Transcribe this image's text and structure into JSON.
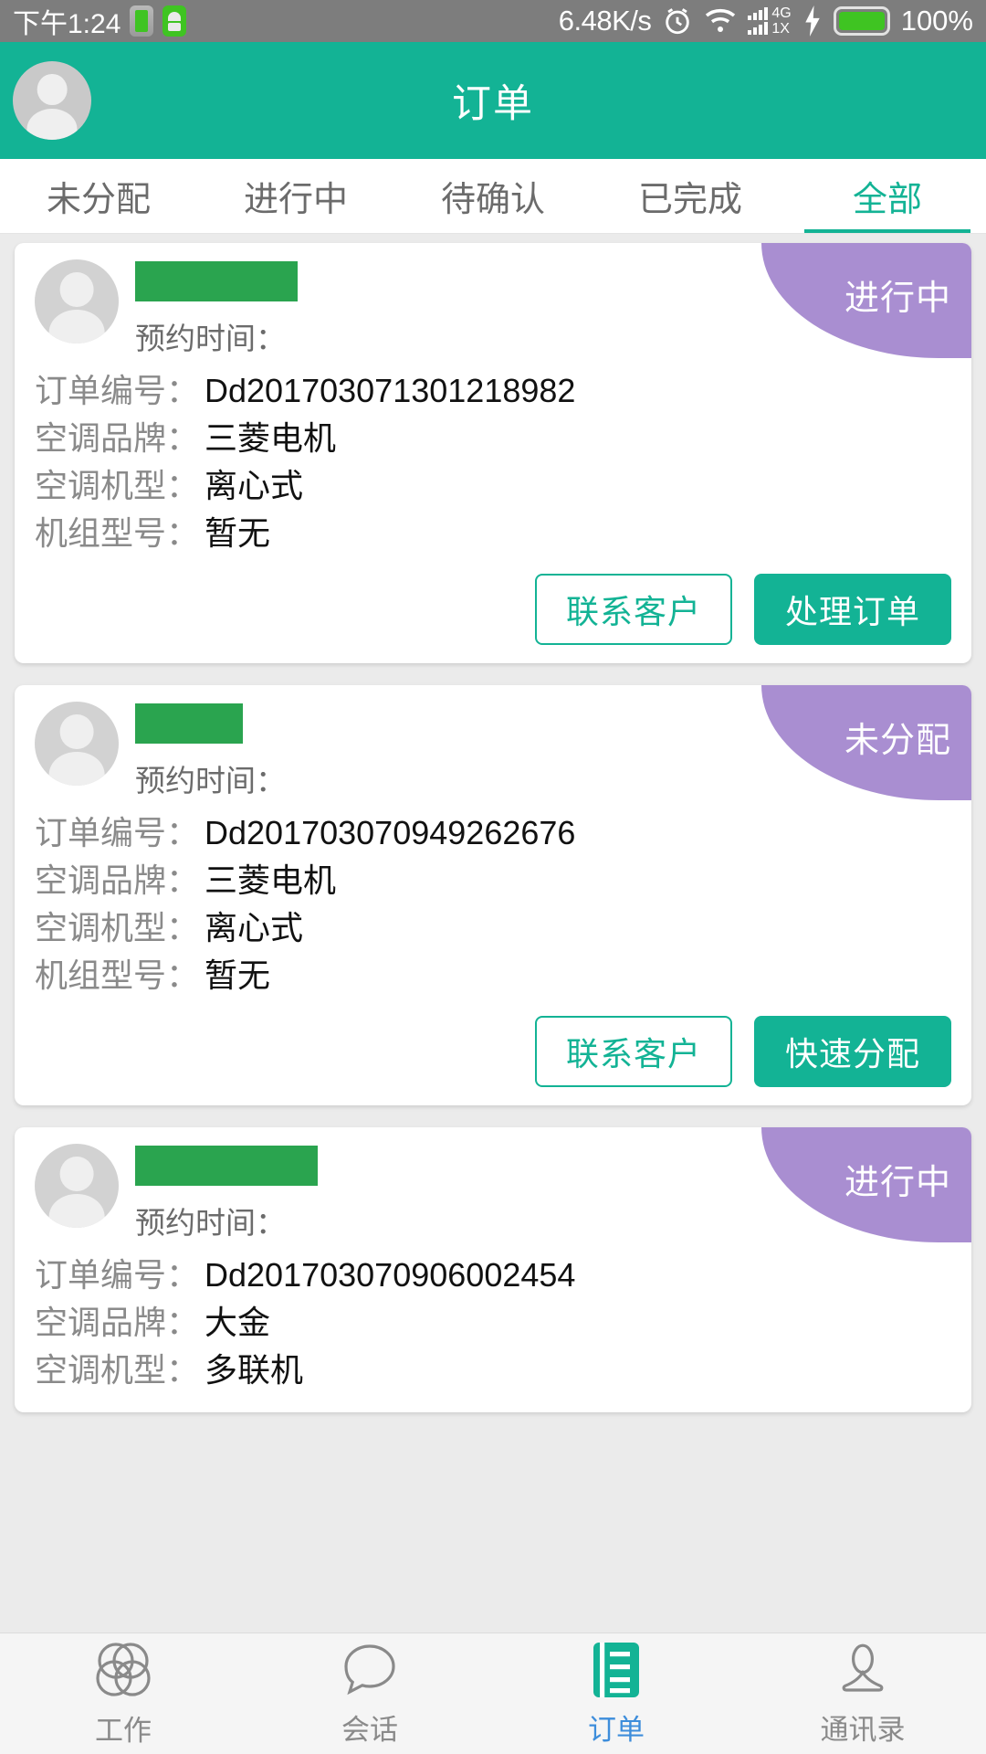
{
  "status_bar": {
    "time": "下午1:24",
    "net_speed": "6.48K/s",
    "network_type": "4G",
    "network_sub": "1X",
    "battery_percent": "100%",
    "icons": [
      "battery-mini-icon",
      "android-robot-icon",
      "alarm-clock-icon",
      "wifi-icon",
      "signal-bars-icon",
      "charging-bolt-icon",
      "battery-icon"
    ],
    "colors": {
      "background": "#7d7d7d",
      "battery_green": "#3fc422"
    }
  },
  "header": {
    "title": "订单",
    "avatar_name": "user-avatar",
    "background": "#13b395"
  },
  "tabs": {
    "active_index": 4,
    "items": [
      {
        "label": "未分配"
      },
      {
        "label": "进行中"
      },
      {
        "label": "待确认"
      },
      {
        "label": "已完成"
      },
      {
        "label": "全部"
      }
    ],
    "active_color": "#13b395",
    "inactive_color": "#6b6b6b"
  },
  "field_labels": {
    "appointment": "预约时间：",
    "order_no": "订单编号：",
    "brand": "空调品牌：",
    "model_type": "空调机型：",
    "unit_model": "机组型号："
  },
  "badge_color": "#a98ed1",
  "redaction_color": "#2aa44f",
  "orders": [
    {
      "status_badge": "进行中",
      "customer_redacted_width": 178,
      "appointment_time": "",
      "order_no": "Dd201703071301218982",
      "brand": "三菱电机",
      "model_type": "离心式",
      "unit_model": "暂无",
      "buttons": {
        "secondary": "联系客户",
        "primary": "处理订单"
      }
    },
    {
      "status_badge": "未分配",
      "customer_redacted_width": 118,
      "appointment_time": "",
      "order_no": "Dd201703070949262676",
      "brand": "三菱电机",
      "model_type": "离心式",
      "unit_model": "暂无",
      "buttons": {
        "secondary": "联系客户",
        "primary": "快速分配"
      }
    },
    {
      "status_badge": "进行中",
      "customer_redacted_width": 200,
      "appointment_time": "",
      "order_no": "Dd201703070906002454",
      "brand": "大金",
      "model_type": "多联机",
      "unit_model": "",
      "buttons": {
        "secondary": "",
        "primary": ""
      }
    }
  ],
  "bottom_nav": {
    "active_index": 2,
    "active_label_color": "#3d8ddb",
    "active_icon_color": "#13b395",
    "items": [
      {
        "label": "工作",
        "icon": "venn-circles-icon"
      },
      {
        "label": "会话",
        "icon": "chat-bubble-icon"
      },
      {
        "label": "订单",
        "icon": "order-document-icon"
      },
      {
        "label": "通讯录",
        "icon": "contacts-person-icon"
      }
    ]
  }
}
